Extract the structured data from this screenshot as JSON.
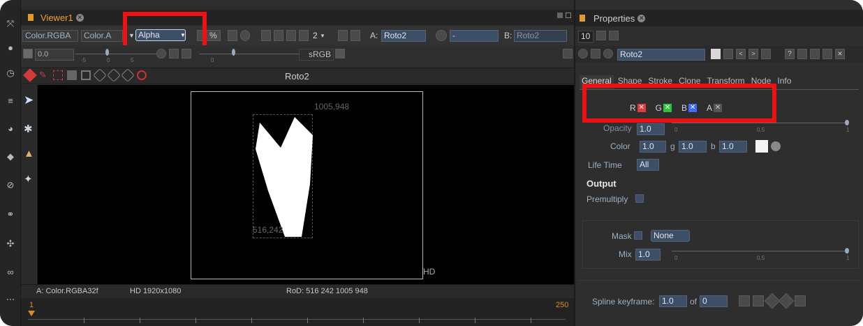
{
  "viewer": {
    "tab_title": "Viewer1",
    "channels_layer": "Color.RGBA",
    "channels_main": "Color.A",
    "display_channel": "Alpha",
    "percent_label": "%",
    "proxy_value": "2",
    "input_a_label": "A:",
    "input_a_value": "Roto2",
    "input_b_label": "B:",
    "input_b_value": "Roto2",
    "gain_value": "0.0",
    "colorspace": "sRGB",
    "node_name": "Roto2",
    "bbox_top_right": "1005,948",
    "bbox_bottom_left": "516,242",
    "format_tag": "HD",
    "status_channels": "A: Color.RGBA32f",
    "status_format": "HD 1920x1080",
    "status_rod": "RoD: 516 242 1005 948",
    "frame_start": "1",
    "frame_end": "250",
    "gain_ticks": [
      "-5",
      "0",
      "5"
    ],
    "gamma_ticks": [
      "0"
    ]
  },
  "properties": {
    "tab_title": "Properties",
    "max_panels": "10",
    "node_name": "Roto2",
    "tabs": [
      "General",
      "Shape",
      "Stroke",
      "Clone",
      "Transform",
      "Node",
      "Info"
    ],
    "channels": [
      {
        "label": "R",
        "color": "#ff4444"
      },
      {
        "label": "G",
        "color": "#44dd44"
      },
      {
        "label": "B",
        "color": "#4466ff"
      },
      {
        "label": "A",
        "color": "#bbbbbb"
      }
    ],
    "opacity_label": "Opacity",
    "opacity_value": "1.0",
    "slider_ticks": [
      "0",
      "0.5",
      "1"
    ],
    "color_label": "Color",
    "color_r": "1.0",
    "color_g_label": "g",
    "color_g": "1.0",
    "color_b_label": "b",
    "color_b": "1.0",
    "life_time_label": "Life Time",
    "life_time_value": "All",
    "output_heading": "Output",
    "premultiply_label": "Premultiply",
    "mask_label": "Mask",
    "mask_value": "None",
    "mix_label": "Mix",
    "mix_value": "1.0",
    "spline_keyframe_label": "Spline keyframe:",
    "spline_keyframe_value": "1.0",
    "spline_of_label": "of",
    "spline_of_value": "0"
  },
  "colors": {
    "highlight": "#ee1111",
    "field_bg": "#3d4f66",
    "panel_bg": "#2b2b2b",
    "timeline_accent": "#e08a1e"
  }
}
